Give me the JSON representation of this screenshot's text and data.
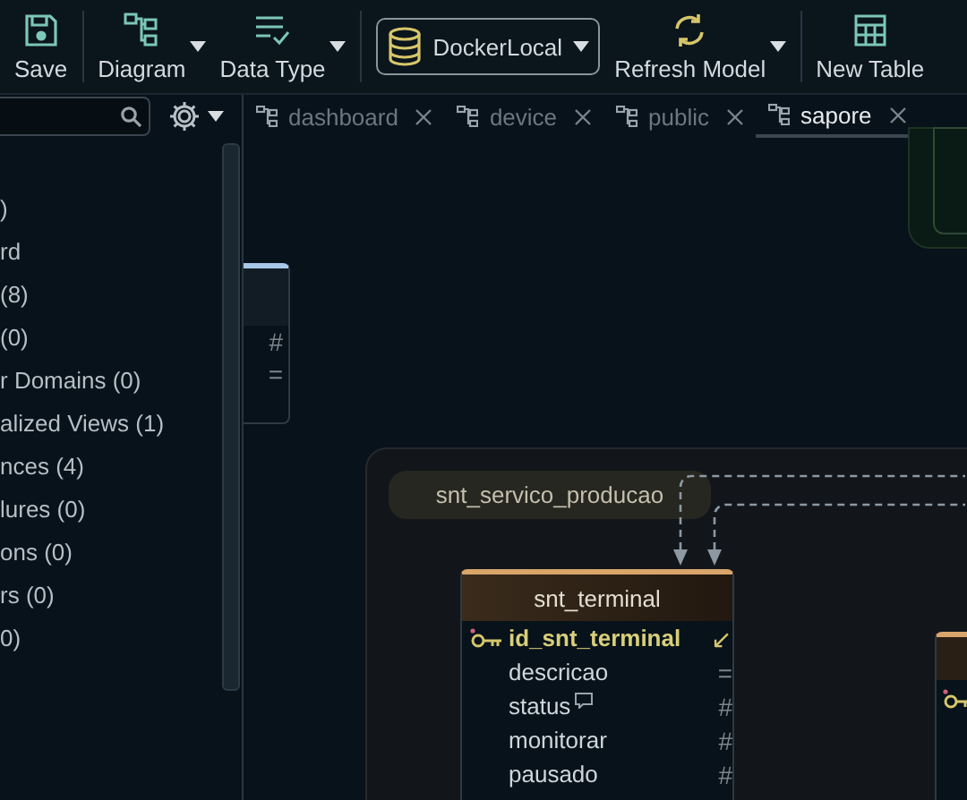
{
  "toolbar": {
    "groups": [
      [
        {
          "kind": "save",
          "label": "Save",
          "caret": false
        }
      ],
      [
        {
          "kind": "diagram",
          "label": "Diagram",
          "caret": true
        },
        {
          "kind": "datatype",
          "label": "Data Type",
          "caret": true
        }
      ],
      [
        {
          "kind": "connection",
          "label": "DockerLocal",
          "caret": true
        },
        {
          "kind": "refresh",
          "label": "Refresh Model",
          "caret": true
        }
      ],
      [
        {
          "kind": "table",
          "label": "New Table",
          "caret": false
        }
      ]
    ]
  },
  "tabs": [
    {
      "label": "dashboard",
      "selected": false
    },
    {
      "label": "device",
      "selected": false
    },
    {
      "label": "public",
      "selected": false
    },
    {
      "label": "sapore",
      "selected": true
    }
  ],
  "sidebar": {
    "items": [
      ")",
      "rd",
      "(8)",
      "(0)",
      "r Domains (0)",
      "alized Views (1)",
      "nces (4)",
      "lures (0)",
      "ons (0)",
      "rs (0)",
      "0)"
    ]
  },
  "canvas": {
    "left_table": {
      "columns": [
        {
          "type": "#"
        },
        {
          "type": "="
        }
      ]
    },
    "group": {
      "label": "snt_servico_producao"
    },
    "table": {
      "name": "snt_terminal",
      "columns": [
        {
          "name": "id_snt_terminal",
          "primary_key": true,
          "comment": false,
          "type": "↙"
        },
        {
          "name": "descricao",
          "primary_key": false,
          "comment": false,
          "type": "="
        },
        {
          "name": "status",
          "primary_key": false,
          "comment": true,
          "type": "#"
        },
        {
          "name": "monitorar",
          "primary_key": false,
          "comment": false,
          "type": "#"
        },
        {
          "name": "pausado",
          "primary_key": false,
          "comment": false,
          "type": "#"
        }
      ]
    },
    "right_table": {
      "columns": [
        {
          "primary_key": true
        }
      ]
    }
  }
}
